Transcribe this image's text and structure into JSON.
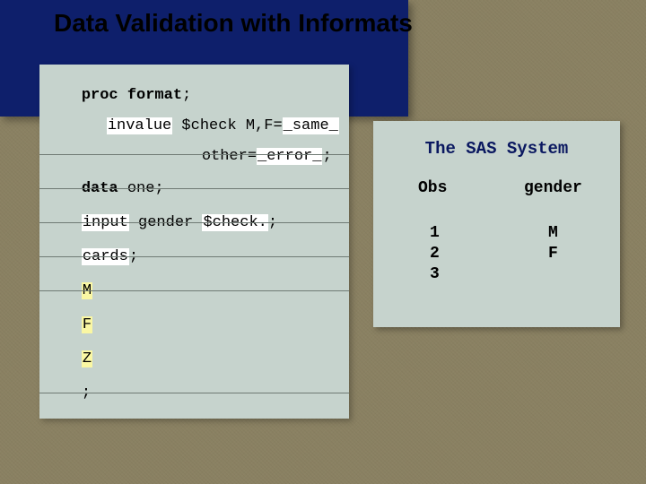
{
  "title": "Data Validation with Informats",
  "code": {
    "l1a": "proc format",
    "l1b": ";",
    "l2a": "invalue",
    "l2b": " $check M,F=",
    "l2c": "_same_",
    "l3a": "other=",
    "l3b": "_error_",
    "l3c": ";",
    "l4a": "data",
    "l4b": " one;",
    "l5a": "input",
    "l5b": " gender ",
    "l5c": "$check.",
    "l5d": ";",
    "l6a": "cards",
    "l6b": ";",
    "l7": "M",
    "l8": "F",
    "l9": "Z",
    "l10": ";"
  },
  "output": {
    "title": "The SAS System",
    "headers": {
      "obs": "Obs",
      "gender": "gender"
    },
    "rows": [
      {
        "obs": "1",
        "gender": "M"
      },
      {
        "obs": "2",
        "gender": "F"
      },
      {
        "obs": "3",
        "gender": ""
      }
    ]
  }
}
